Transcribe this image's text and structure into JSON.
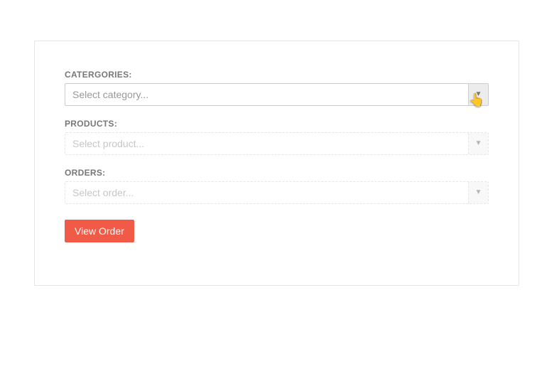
{
  "form": {
    "categories": {
      "label": "CATERGORIES:",
      "placeholder": "Select category...",
      "enabled": true
    },
    "products": {
      "label": "PRODUCTS:",
      "placeholder": "Select product...",
      "enabled": false
    },
    "orders": {
      "label": "ORDERS:",
      "placeholder": "Select order...",
      "enabled": false
    },
    "submit_label": "View Order"
  },
  "colors": {
    "accent": "#f05a46"
  }
}
